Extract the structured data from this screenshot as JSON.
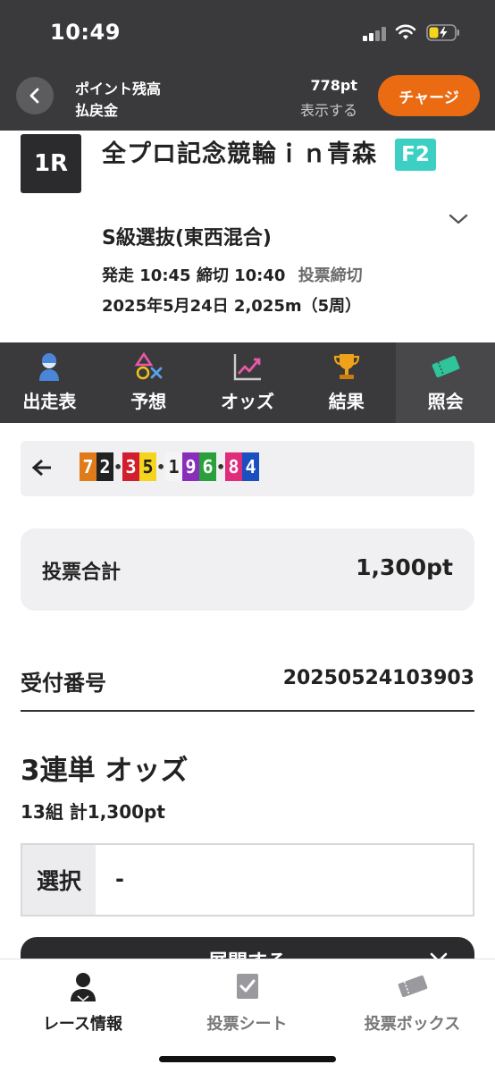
{
  "status_bar": {
    "time": "10:49"
  },
  "header": {
    "points_label": "ポイント残高",
    "refund_label": "払戻金",
    "points_value": "778pt",
    "show_link": "表示する",
    "charge_button": "チャージ"
  },
  "race": {
    "number": "1R",
    "name": "全プロ記念競輪ｉｎ青森",
    "grade": "F2",
    "class": "S級選抜(東西混合)",
    "start_time": "発走 10:45",
    "deadline": "締切 10:40",
    "status": "投票締切",
    "date_info": "2025年5月24日 2,025m（5周）"
  },
  "tabs": [
    {
      "label": "出走表",
      "icon": "rider-icon"
    },
    {
      "label": "予想",
      "icon": "prediction-icon"
    },
    {
      "label": "オッズ",
      "icon": "odds-chart-icon"
    },
    {
      "label": "結果",
      "icon": "trophy-icon"
    },
    {
      "label": "照会",
      "icon": "ticket-icon",
      "active": true
    }
  ],
  "combination": {
    "groups": [
      [
        {
          "n": "7",
          "bg": "#e07b1a",
          "fg": "#ffffff"
        },
        {
          "n": "2",
          "bg": "#222222",
          "fg": "#ffffff"
        }
      ],
      [
        {
          "n": "3",
          "bg": "#d11f2f",
          "fg": "#ffffff"
        },
        {
          "n": "5",
          "bg": "#f6d31c",
          "fg": "#222222"
        }
      ],
      [
        {
          "n": "1",
          "bg": "#f4f4f4",
          "fg": "#222222"
        },
        {
          "n": "9",
          "bg": "#8a2dbb",
          "fg": "#ffffff"
        },
        {
          "n": "6",
          "bg": "#2aa03a",
          "fg": "#ffffff"
        }
      ],
      [
        {
          "n": "8",
          "bg": "#df2c7b",
          "fg": "#ffffff"
        },
        {
          "n": "4",
          "bg": "#1b4fbf",
          "fg": "#ffffff"
        }
      ]
    ]
  },
  "total": {
    "label": "投票合計",
    "value": "1,300pt"
  },
  "receipt": {
    "label": "受付番号",
    "value": "20250524103903"
  },
  "odds": {
    "title": "3連単 オッズ",
    "summary": "13組 計1,300pt",
    "select_label": "選択",
    "select_value": "-",
    "expand_label": "展開する"
  },
  "bottom_nav": [
    {
      "label": "レース情報",
      "icon": "person-icon",
      "active": true
    },
    {
      "label": "投票シート",
      "icon": "check-sheet-icon"
    },
    {
      "label": "投票ボックス",
      "icon": "ticket-box-icon"
    }
  ]
}
